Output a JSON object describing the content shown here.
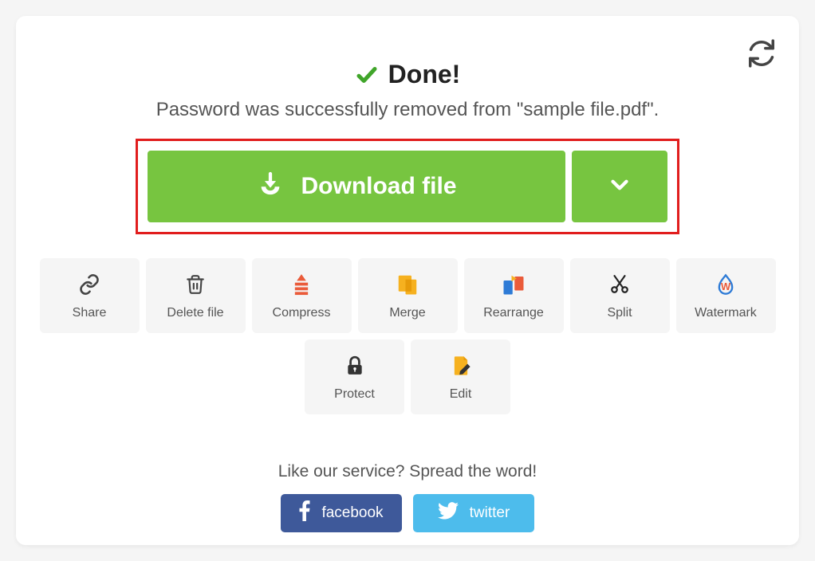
{
  "header": {
    "title": "Done!",
    "subtitle": "Password was successfully removed from \"sample file.pdf\"."
  },
  "download": {
    "label": "Download file"
  },
  "actions": [
    {
      "id": "share",
      "label": "Share"
    },
    {
      "id": "delete",
      "label": "Delete file"
    },
    {
      "id": "compress",
      "label": "Compress"
    },
    {
      "id": "merge",
      "label": "Merge"
    },
    {
      "id": "rearrange",
      "label": "Rearrange"
    },
    {
      "id": "split",
      "label": "Split"
    },
    {
      "id": "watermark",
      "label": "Watermark"
    },
    {
      "id": "protect",
      "label": "Protect"
    },
    {
      "id": "edit",
      "label": "Edit"
    }
  ],
  "spread": {
    "text": "Like our service? Spread the word!",
    "facebook": "facebook",
    "twitter": "twitter"
  },
  "colors": {
    "accent_green": "#77c540",
    "highlight_red": "#e11d1d",
    "facebook": "#3e599a",
    "twitter": "#4dbcec"
  }
}
